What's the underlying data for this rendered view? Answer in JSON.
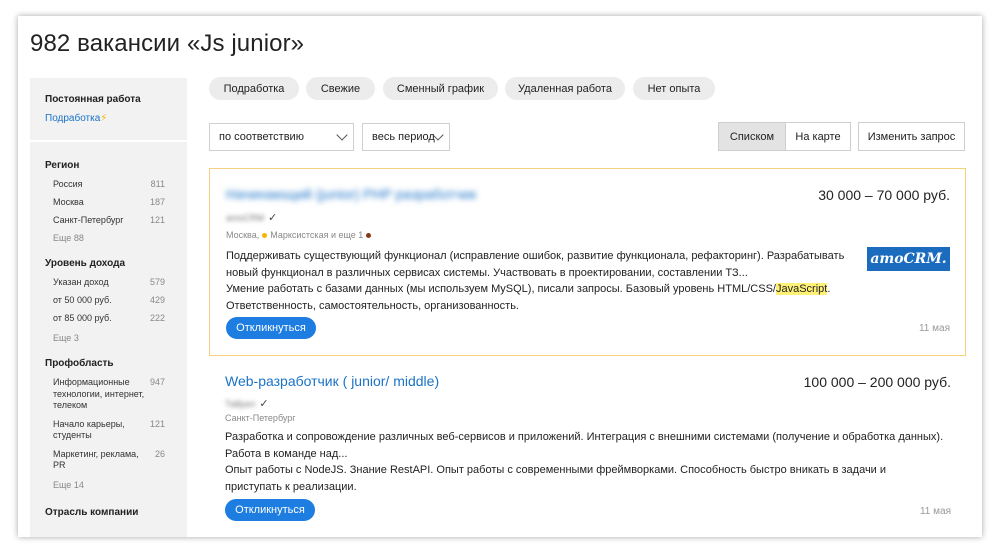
{
  "page": {
    "title": "982 вакансии «Js junior»"
  },
  "sidebar": {
    "employment_heading": "Постоянная работа",
    "employment_link": "Подработка",
    "region": {
      "heading": "Регион",
      "items": [
        {
          "label": "Россия",
          "count": "811"
        },
        {
          "label": "Москва",
          "count": "187"
        },
        {
          "label": "Санкт-Петербург",
          "count": "121"
        }
      ],
      "more": "Еще 88"
    },
    "income": {
      "heading": "Уровень дохода",
      "items": [
        {
          "label": "Указан доход",
          "count": "579"
        },
        {
          "label": "от 50 000 руб.",
          "count": "429"
        },
        {
          "label": "от 85 000 руб.",
          "count": "222"
        }
      ],
      "more": "Еще 3"
    },
    "profarea": {
      "heading": "Профобласть",
      "items": [
        {
          "label": "Информационные технологии, интернет, телеком",
          "count": "947"
        },
        {
          "label": "Начало карьеры, студенты",
          "count": "121"
        },
        {
          "label": "Маркетинг, реклама, PR",
          "count": "26"
        }
      ],
      "more": "Еще 14"
    },
    "industry_heading": "Отрасль компании"
  },
  "chips": [
    "Подработка",
    "Свежие",
    "Сменный график",
    "Удаленная работа",
    "Нет опыта"
  ],
  "controls": {
    "sort": "по соответствию",
    "period": "весь период",
    "view_list": "Списком",
    "view_map": "На карте",
    "change_query": "Изменить запрос"
  },
  "vacancies": [
    {
      "title": "Начинающий (junior) PHP разработчик",
      "salary": "30 000 – 70 000 руб.",
      "company": "amoCRM",
      "location": "Москва,",
      "metro": "Марксистская и еще 1",
      "text": [
        "Поддерживать существующий функционал (исправление ошибок, развитие функционала, рефакторинг). Разрабатывать новый функционал в различных сервисах системы. Участвовать в проектировании, составлении ТЗ...",
        "Умение работать с базами данных (мы используем MySQL), писали запросы. Базовый уровень HTML/CSS/",
        "JavaScript",
        ". Ответственность, самостоятельность, организованность."
      ],
      "apply": "Откликнуться",
      "date": "11 мая",
      "logo": "amoCRM."
    },
    {
      "title": "Web-разработчик ( junior/ middle)",
      "salary": "100 000 – 200 000 руб.",
      "company": "Тайрил",
      "location": "Санкт-Петербург",
      "text": [
        "Разработка и сопровождение различных веб-сервисов и приложений. Интеграция с внешними системами (получение и обработка данных). Работа в команде над...",
        "Опыт работы с NodeJS. Знание RestAPI. Опыт работы с современными фреймворками. Способность быстро вникать в задачи и приступать к реализации."
      ],
      "apply": "Откликнуться",
      "date": "11 мая"
    }
  ],
  "colors": {
    "accent": "#1e7de0",
    "link": "#1a73c8",
    "premium_border": "#f5d17e",
    "highlight": "#fff176"
  }
}
